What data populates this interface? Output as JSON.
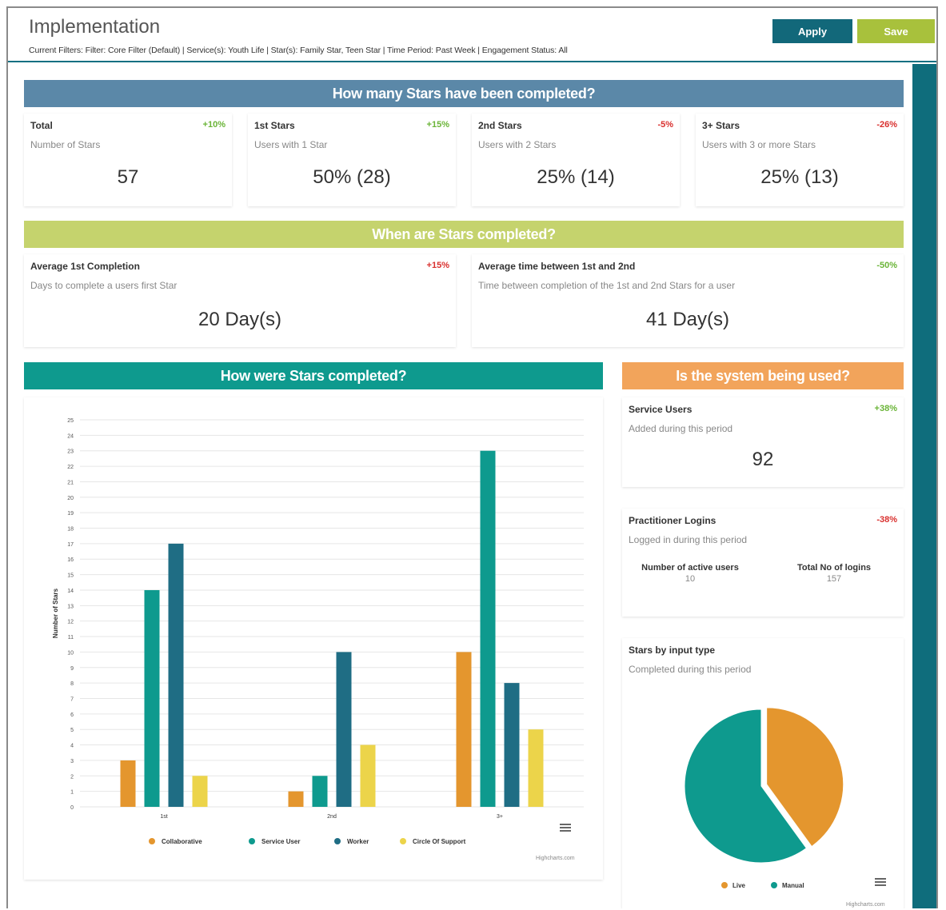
{
  "header": {
    "title": "Implementation",
    "filters": "Current Filters: Filter: Core Filter (Default) | Service(s): Youth Life | Star(s): Family Star, Teen Star | Time Period: Past Week | Engagement Status: All",
    "apply_label": "Apply",
    "save_label": "Save"
  },
  "colors": {
    "primary": "#12687a",
    "accent_green": "#a8c13c",
    "section_blue": "#5b88a8",
    "section_green": "#c5d36d",
    "section_teal": "#0e9a8e",
    "section_orange": "#f2a45b",
    "positive": "#6ab437",
    "negative": "#d9302e"
  },
  "section1": {
    "title": "How many Stars have been completed?",
    "cards": [
      {
        "title": "Total",
        "change": "+10%",
        "sub": "Number of Stars",
        "value": "57"
      },
      {
        "title": "1st Stars",
        "change": "+15%",
        "sub": "Users with 1 Star",
        "value": "50% (28)"
      },
      {
        "title": "2nd Stars",
        "change": "-5%",
        "sub": "Users with 2 Stars",
        "value": "25% (14)"
      },
      {
        "title": "3+ Stars",
        "change": "-26%",
        "sub": "Users with 3 or more Stars",
        "value": "25% (13)"
      }
    ]
  },
  "section2": {
    "title": "When are Stars completed?",
    "cards": [
      {
        "title": "Average 1st Completion",
        "change": "+15%",
        "sub": "Days to complete a users first Star",
        "value": "20 Day(s)"
      },
      {
        "title": "Average time between 1st and 2nd",
        "change": "-50%",
        "sub": "Time between completion of the 1st and 2nd Stars for a user",
        "value": "41 Day(s)"
      }
    ]
  },
  "section3": {
    "title": "How were Stars completed?",
    "credit": "Highcharts.com"
  },
  "section4": {
    "title": "Is the system being used?",
    "service_users": {
      "title": "Service Users",
      "change": "+38%",
      "sub": "Added during this period",
      "value": "92"
    },
    "logins": {
      "title": "Practitioner Logins",
      "change": "-38%",
      "sub": "Logged in during this period",
      "active_label": "Number of active users",
      "active_value": "10",
      "total_label": "Total No of logins",
      "total_value": "157"
    },
    "input_type": {
      "title": "Stars by input type",
      "sub": "Completed during this period",
      "credit": "Highcharts.com"
    }
  },
  "chart_data": [
    {
      "type": "bar",
      "ylabel": "Number of Stars",
      "categories": [
        "1st",
        "2nd",
        "3+"
      ],
      "ylim": [
        0,
        25
      ],
      "yticks": [
        0,
        1,
        2,
        3,
        4,
        5,
        6,
        7,
        8,
        9,
        10,
        11,
        12,
        13,
        14,
        15,
        16,
        17,
        18,
        19,
        20,
        21,
        22,
        23,
        24,
        25
      ],
      "series": [
        {
          "name": "Collaborative",
          "color": "#e4962e",
          "values": [
            3,
            1,
            10
          ]
        },
        {
          "name": "Service User",
          "color": "#0e9a8e",
          "values": [
            14,
            2,
            23
          ]
        },
        {
          "name": "Worker",
          "color": "#1f6d84",
          "values": [
            17,
            10,
            8
          ]
        },
        {
          "name": "Circle Of Support",
          "color": "#ecd44a",
          "values": [
            2,
            4,
            5
          ]
        }
      ]
    },
    {
      "type": "pie",
      "slices": [
        {
          "name": "Live",
          "color": "#e4962e",
          "value": 40
        },
        {
          "name": "Manual",
          "color": "#0e9a8e",
          "value": 60
        }
      ]
    }
  ]
}
